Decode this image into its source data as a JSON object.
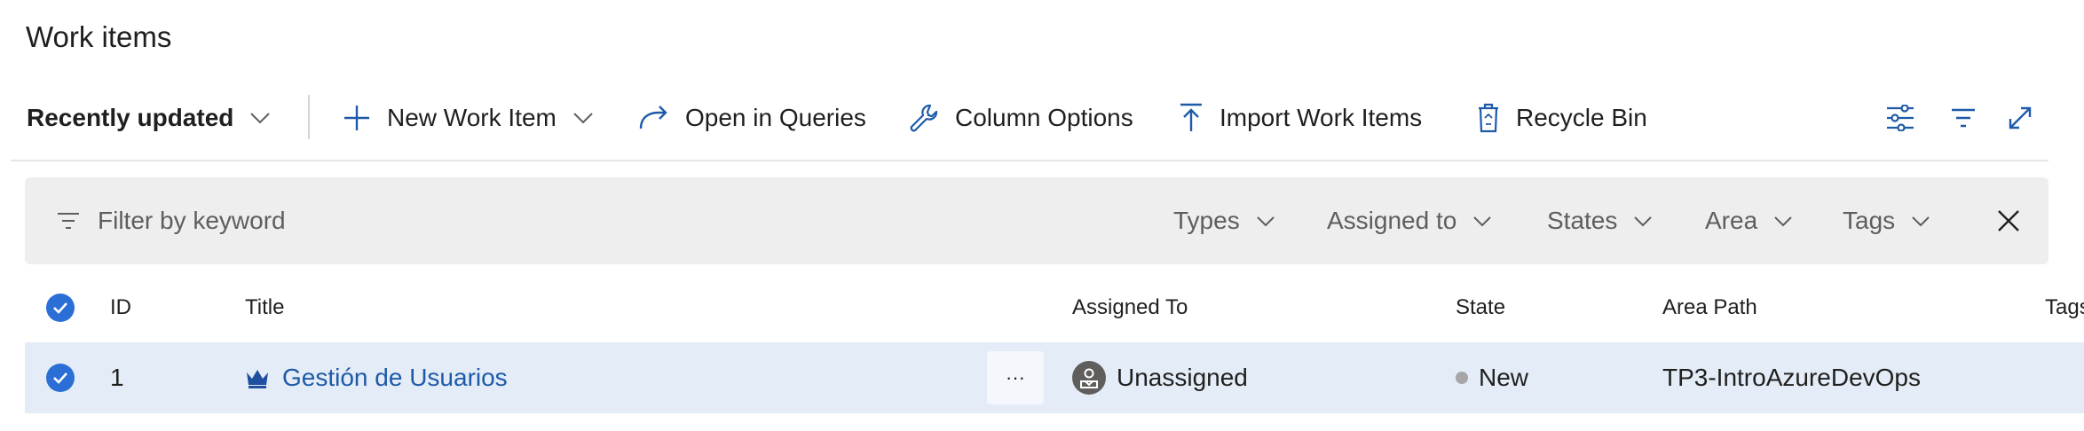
{
  "page": {
    "title": "Work items"
  },
  "toolbar": {
    "view_selector": "Recently updated",
    "new_work_item": "New Work Item",
    "open_in_queries": "Open in Queries",
    "column_options": "Column Options",
    "import_work_items": "Import Work Items",
    "recycle_bin": "Recycle Bin",
    "right_icons": [
      "view-options-icon",
      "filter-icon",
      "fullscreen-icon"
    ]
  },
  "filter": {
    "placeholder": "Filter by keyword",
    "pills": [
      "Types",
      "Assigned to",
      "States",
      "Area",
      "Tags"
    ],
    "close_icon": "close-icon"
  },
  "table": {
    "columns": {
      "id": "ID",
      "title": "Title",
      "assigned_to": "Assigned To",
      "state": "State",
      "area_path": "Area Path",
      "tags": "Tags"
    },
    "rows": [
      {
        "id": "1",
        "type_icon": "epic-crown-icon",
        "title": "Gestión de Usuarios",
        "more": "···",
        "assigned_to": "Unassigned",
        "state": "New",
        "area_path": "TP3-IntroAzureDevOps",
        "selected": true
      }
    ]
  },
  "colors": {
    "accent": "#2b6fd6",
    "link": "#1e5aa8",
    "epic_icon": "#1f4fa0",
    "selected_row": "#e3ecf7",
    "filter_bar": "#eeeeee",
    "state_new": "#a6a6a6"
  }
}
